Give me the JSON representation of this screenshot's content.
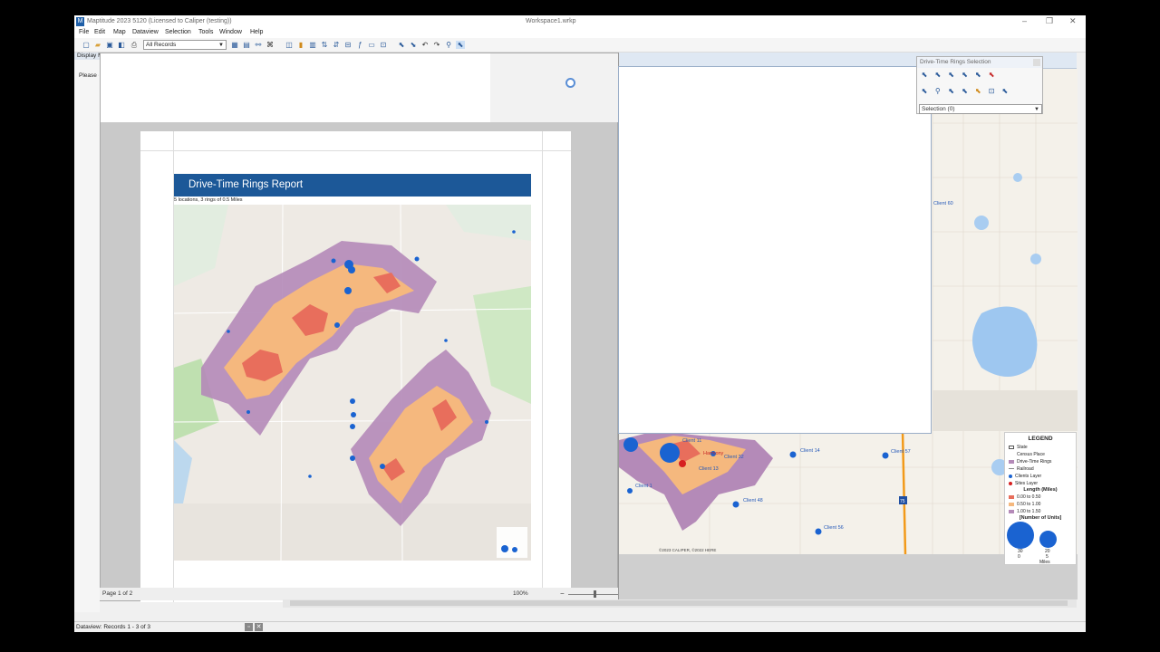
{
  "window": {
    "title": "Maptitude 2023 5120 (Licensed to Caliper (testing))",
    "workspace": "Workspace1.wrkp",
    "controls": [
      "–",
      "❐",
      "✕"
    ]
  },
  "menu": [
    "File",
    "Edit",
    "Map",
    "Dataview",
    "Selection",
    "Tools",
    "Window",
    "Help"
  ],
  "toolbar": {
    "record_filter": "All Records"
  },
  "left_panel": {
    "header": "Display Manager",
    "message": "Please open a map"
  },
  "report": {
    "title": "Drive-Time Rings Report",
    "subtitle": "5 locations, 3 rings of 0.5 Miles",
    "page_indicator": "Page 1 of 2",
    "zoom": "100%"
  },
  "drive_time_selection": {
    "title": "Drive-Time Rings Selection",
    "selection_label": "Selection (0)"
  },
  "map": {
    "client_labels": [
      "Client 11",
      "Client 32",
      "Client 13",
      "Client 14",
      "Client 57",
      "Client 1",
      "Client 48",
      "Client 56",
      "Client 60",
      "Harmony"
    ],
    "copyright": "©2023 CALIPER, ©2022 HERE",
    "highway": "75",
    "legend": {
      "title": "LEGEND",
      "items": [
        "State",
        "Census Place",
        "Drive-Time Rings",
        "Railroad",
        "Clients Layer",
        "Sites Layer"
      ],
      "length_title": "Length (Miles)",
      "length_items": [
        "0.00 to 0.50",
        "0.50 to 1.00",
        "1.00 to 1.50"
      ],
      "units_title": "[Number of Units]",
      "units_values": [
        "30",
        "20",
        "0",
        "5"
      ],
      "scale": "Miles"
    }
  },
  "status_bar": {
    "text": "Dataview: Records 1 - 3 of 3"
  },
  "colors": {
    "ring_inner": "#e86e5c",
    "ring_middle": "#f5b87e",
    "ring_outer": "#b48ab8",
    "client_dot": "#1a63d1",
    "site_dot": "#d62020",
    "report_banner": "#1c5898"
  }
}
